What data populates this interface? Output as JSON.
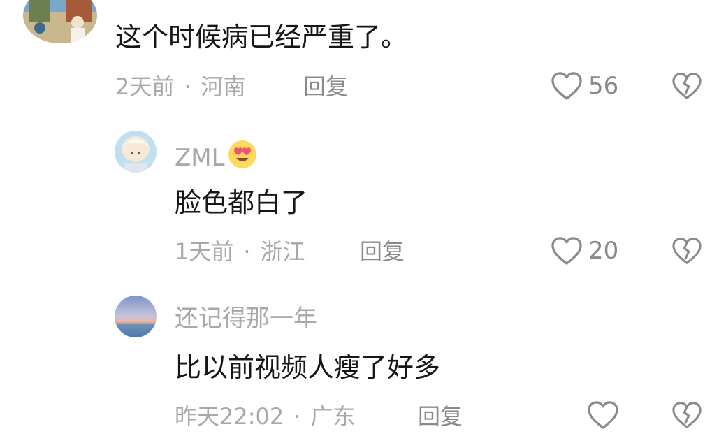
{
  "comments": [
    {
      "username": "",
      "text": "这个时候病已经严重了。",
      "time": "2天前",
      "location": "河南",
      "reply_label": "回复",
      "likes": "56"
    },
    {
      "username": "ZML",
      "username_emoji": "heart-eyes-emoji",
      "text": "脸色都白了",
      "time": "1天前",
      "location": "浙江",
      "reply_label": "回复",
      "likes": "20"
    },
    {
      "username": "还记得那一年",
      "text": "比以前视频人瘦了好多",
      "time": "昨天22:02",
      "location": "广东",
      "reply_label": "回复",
      "likes": ""
    }
  ],
  "separator": "·",
  "icons": {
    "like": "heart-outline-icon",
    "dislike": "broken-heart-icon"
  },
  "colors": {
    "text": "#161616",
    "meta": "#a8a8a8",
    "icon": "#8a8a8a"
  }
}
